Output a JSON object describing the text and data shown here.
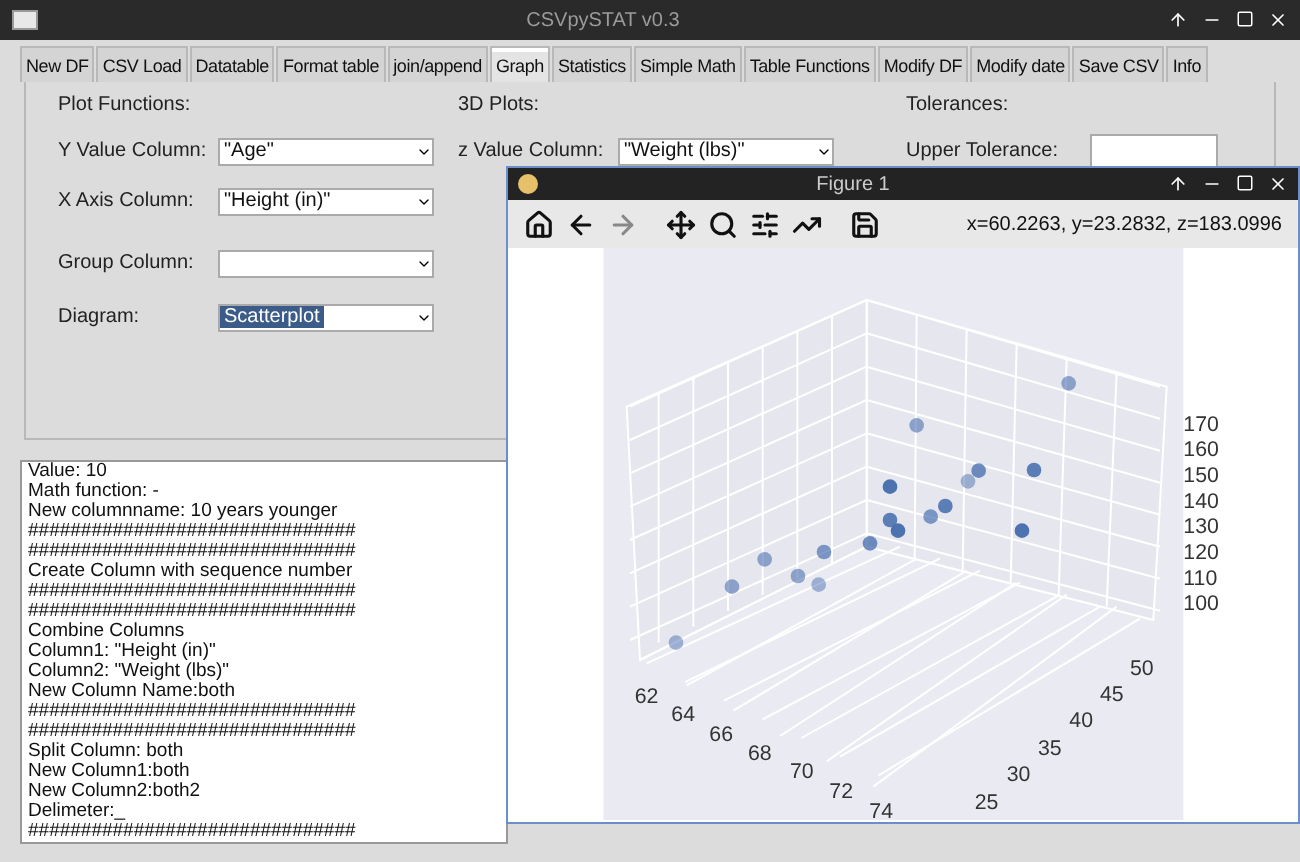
{
  "window": {
    "title": "CSVpySTAT v0.3"
  },
  "tabs": [
    {
      "label": "New DF",
      "selected": false
    },
    {
      "label": "CSV Load",
      "selected": false
    },
    {
      "label": "Datatable",
      "selected": false
    },
    {
      "label": "Format table",
      "selected": false
    },
    {
      "label": "join/append",
      "selected": false
    },
    {
      "label": "Graph",
      "selected": true
    },
    {
      "label": "Statistics",
      "selected": false
    },
    {
      "label": "Simple Math",
      "selected": false
    },
    {
      "label": "Table Functions",
      "selected": false
    },
    {
      "label": "Modify DF",
      "selected": false
    },
    {
      "label": "Modify date",
      "selected": false
    },
    {
      "label": "Save CSV",
      "selected": false
    },
    {
      "label": "Info",
      "selected": false
    }
  ],
  "plot_functions": {
    "heading": "Plot Functions:",
    "fields": [
      {
        "label": "Y Value Column:",
        "value": "\"Age\"",
        "highlighted": false
      },
      {
        "label": "X Axis Column:",
        "value": "\"Height (in)\"",
        "highlighted": false
      },
      {
        "label": "Group Column:"
      },
      {
        "label": "Diagram:",
        "value": "Scatterplot",
        "highlighted": true
      }
    ]
  },
  "plots_3d": {
    "heading": "3D Plots:",
    "field": {
      "label": "z Value Column:",
      "value": "\"Weight (lbs)\""
    }
  },
  "tolerances": {
    "heading": "Tolerances:",
    "field": {
      "label": "Upper Tolerance:"
    }
  },
  "log_lines": [
    "Value: 10",
    "Math function: -",
    "New columnname: 10 years younger",
    "###############################",
    "###############################",
    "Create Column with sequence number",
    "###############################",
    "###############################",
    "Combine Columns",
    "Column1: \"Height (in)\"",
    "Column2: \"Weight (lbs)\"",
    "New Column Name:both",
    "###############################",
    "###############################",
    "Split Column: both",
    "New Column1:both",
    "New Column2:both2",
    "Delimeter:_",
    "###############################"
  ],
  "figure": {
    "title": "Figure 1",
    "toolbar": [
      {
        "kind": "home",
        "disabled": false
      },
      {
        "kind": "back",
        "disabled": false
      },
      {
        "kind": "forward",
        "disabled": true
      },
      {
        "kind": "pan",
        "disabled": false
      },
      {
        "kind": "zoom",
        "disabled": false
      },
      {
        "kind": "subplots",
        "disabled": false
      },
      {
        "kind": "axes",
        "disabled": false
      },
      {
        "kind": "save",
        "disabled": false
      }
    ],
    "coordinates": "x=60.2263, y=23.2832, z=183.0996",
    "x_ticks": [
      "62",
      "64",
      "66",
      "68",
      "70",
      "72",
      "74"
    ],
    "y_ticks": [
      "25",
      "30",
      "35",
      "40",
      "45",
      "50"
    ],
    "z_ticks": [
      "170",
      "160",
      "150",
      "140",
      "130",
      "120",
      "110",
      "100"
    ]
  }
}
